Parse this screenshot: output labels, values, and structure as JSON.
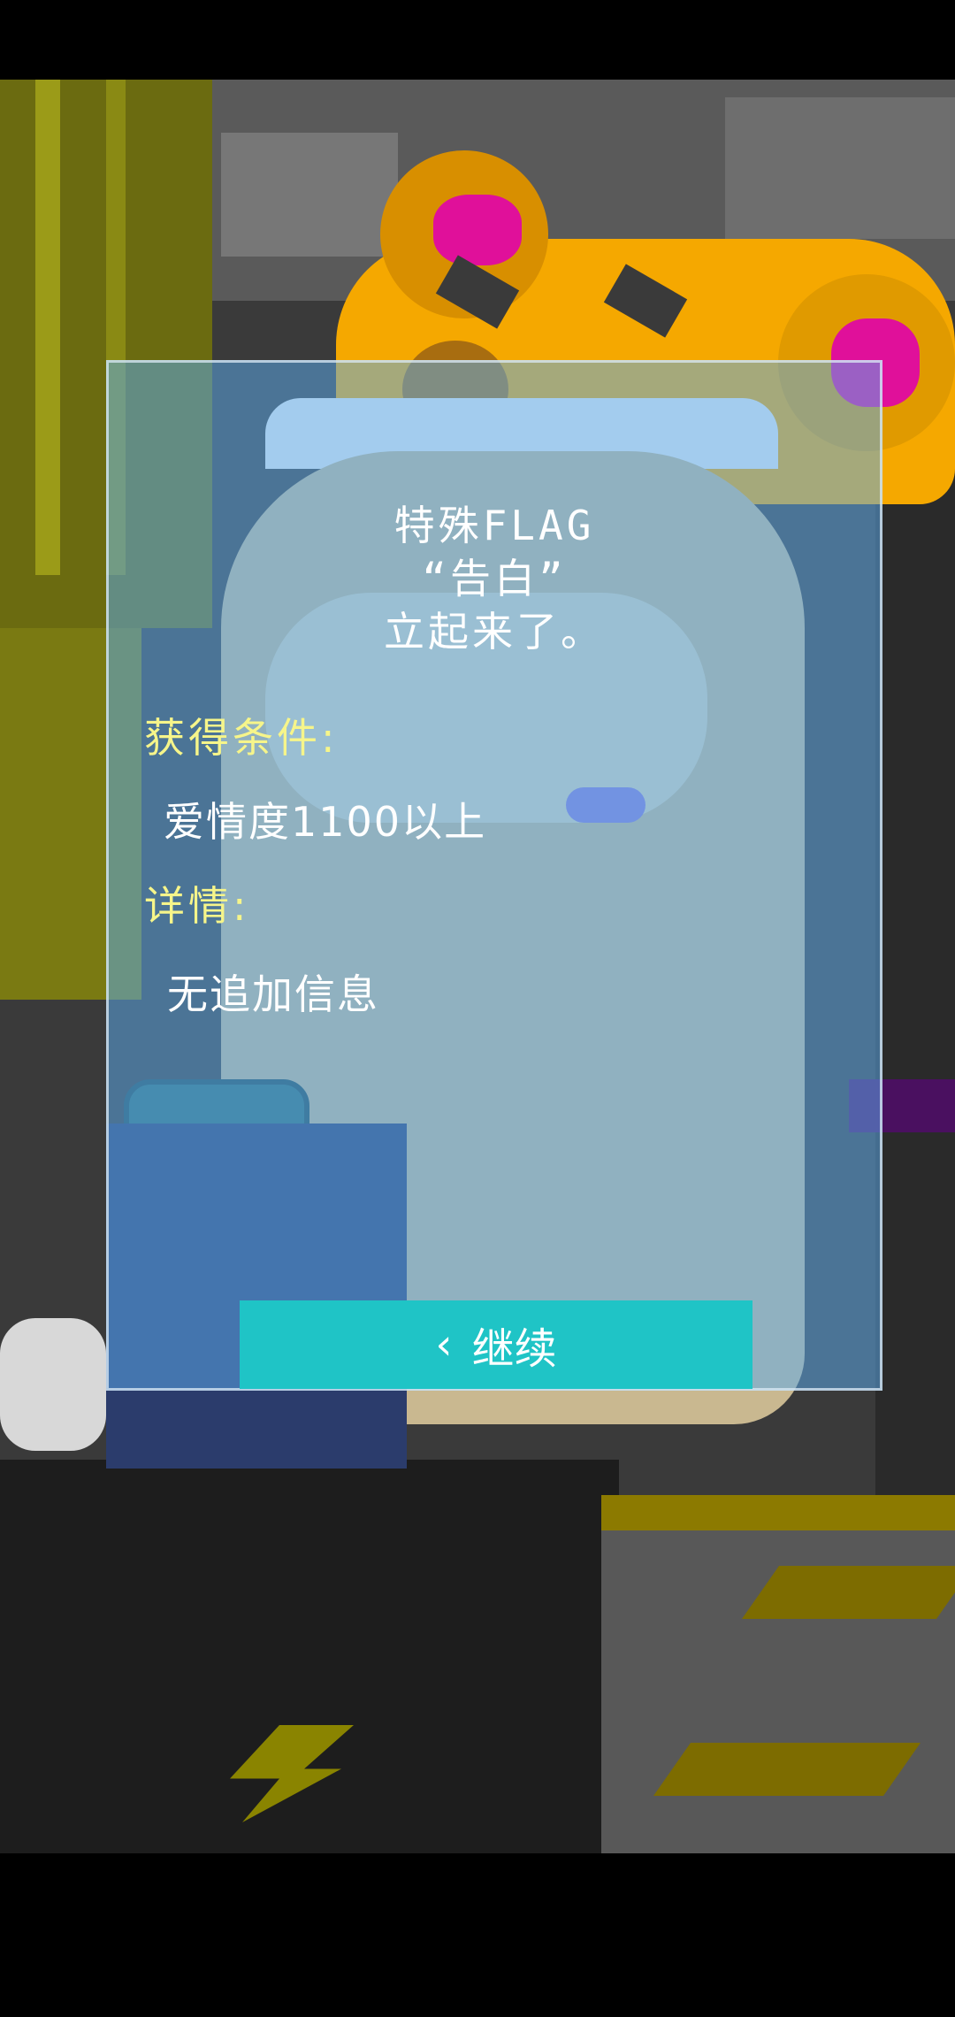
{
  "dialog": {
    "title_lines": [
      "特殊FLAG",
      "“告白”",
      "立起来了。"
    ],
    "condition_label": "获得条件:",
    "condition_value": "爱情度1100以上",
    "detail_label": "详情:",
    "detail_value": "无追加信息",
    "continue_label": "继续",
    "continue_icon": "chevron-left-icon"
  },
  "colors": {
    "panel": "#5caaeb",
    "yellow_text": "#f6f58a",
    "button": "#1fc4c6",
    "mascot_orange": "#f5a800",
    "mascot_pink": "#e0109a"
  }
}
